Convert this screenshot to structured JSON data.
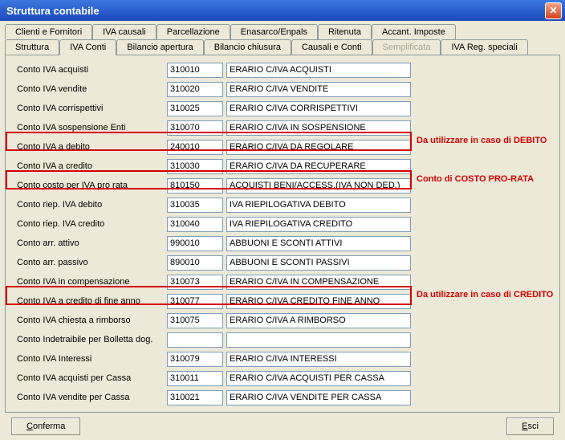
{
  "window": {
    "title": "Struttura contabile"
  },
  "tabs_row1": [
    {
      "label": "Clienti e Fornitori"
    },
    {
      "label": "IVA causali"
    },
    {
      "label": "Parcellazione"
    },
    {
      "label": "Enasarco/Enpals"
    },
    {
      "label": "Ritenuta"
    },
    {
      "label": "Accant. Imposte"
    }
  ],
  "tabs_row2": [
    {
      "label": "Struttura"
    },
    {
      "label": "IVA Conti",
      "active": true
    },
    {
      "label": "Bilancio apertura"
    },
    {
      "label": "Bilancio chiusura"
    },
    {
      "label": "Causali e Conti"
    },
    {
      "label": "Semplificata",
      "disabled": true
    },
    {
      "label": "IVA Reg. speciali"
    }
  ],
  "rows": [
    {
      "label": "Conto IVA acquisti",
      "code": "310010",
      "desc": "ERARIO C/IVA ACQUISTI"
    },
    {
      "label": "Conto IVA vendite",
      "code": "310020",
      "desc": "ERARIO C/IVA VENDITE"
    },
    {
      "label": "Conto IVA corrispettivi",
      "code": "310025",
      "desc": "ERARIO C/IVA CORRISPETTIVI"
    },
    {
      "label": "Conto IVA sospensione Enti",
      "code": "310070",
      "desc": "ERARIO C/IVA IN SOSPENSIONE"
    },
    {
      "label": "Conto IVA a debito",
      "code": "240010",
      "desc": "ERARIO C/IVA DA REGOLARE",
      "highlight": true,
      "note": "Da utilizzare in caso di DEBITO"
    },
    {
      "label": "Conto IVA a credito",
      "code": "310030",
      "desc": "ERARIO C/IVA DA RECUPERARE"
    },
    {
      "label": "Conto costo per IVA pro rata",
      "code": "810150",
      "desc": "ACQUISTI BENI/ACCESS.(IVA NON DED.)",
      "highlight": true,
      "note": "Conto di COSTO PRO-RATA"
    },
    {
      "label": "Conto riep. IVA debito",
      "code": "310035",
      "desc": "IVA RIEPILOGATIVA DEBITO"
    },
    {
      "label": "Conto riep. IVA credito",
      "code": "310040",
      "desc": "IVA RIEPILOGATIVA CREDITO"
    },
    {
      "label": "Conto arr. attivo",
      "code": "990010",
      "desc": "ABBUONI E SCONTI ATTIVI"
    },
    {
      "label": "Conto arr. passivo",
      "code": "890010",
      "desc": "ABBUONI E SCONTI PASSIVI"
    },
    {
      "label": "Conto IVA in compensazione",
      "code": "310073",
      "desc": "ERARIO C/IVA IN COMPENSAZIONE"
    },
    {
      "label": "Conto IVA a credito di fine anno",
      "code": "310077",
      "desc": "ERARIO C/IVA CREDITO FINE ANNO",
      "highlight": true,
      "note": "Da utilizzare in caso di CREDITO"
    },
    {
      "label": "Conto IVA chiesta a rimborso",
      "code": "310075",
      "desc": "ERARIO C/IVA A RIMBORSO"
    },
    {
      "label": "Conto Indetraibile per Bolletta dog.",
      "code": "",
      "desc": ""
    },
    {
      "label": "Conto IVA Interessi",
      "code": "310079",
      "desc": "ERARIO C/IVA INTERESSI"
    },
    {
      "label": "Conto IVA acquisti per Cassa",
      "code": "310011",
      "desc": "ERARIO C/IVA ACQUISTI PER CASSA"
    },
    {
      "label": "Conto IVA vendite per Cassa",
      "code": "310021",
      "desc": "ERARIO C/IVA VENDITE PER CASSA"
    }
  ],
  "buttons": {
    "confirm": "Conferma",
    "exit": "Esci"
  }
}
